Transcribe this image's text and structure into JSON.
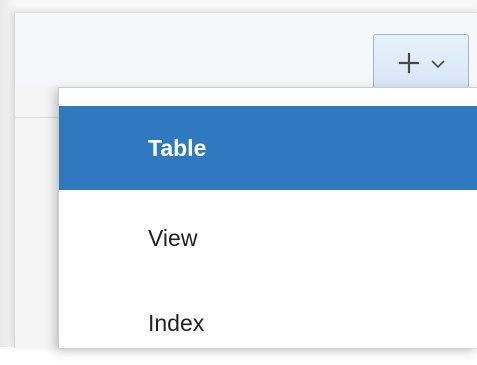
{
  "toolbar": {
    "add_button_icon": "plus-icon",
    "dropdown_icon": "chevron-down-icon"
  },
  "menu": {
    "items": [
      {
        "label": "Table",
        "selected": true
      },
      {
        "label": "View",
        "selected": false
      },
      {
        "label": "Index",
        "selected": false
      }
    ]
  },
  "colors": {
    "selection": "#2f79c0",
    "button_bg": "#dbe9f8",
    "button_border": "#9fb8d1"
  }
}
